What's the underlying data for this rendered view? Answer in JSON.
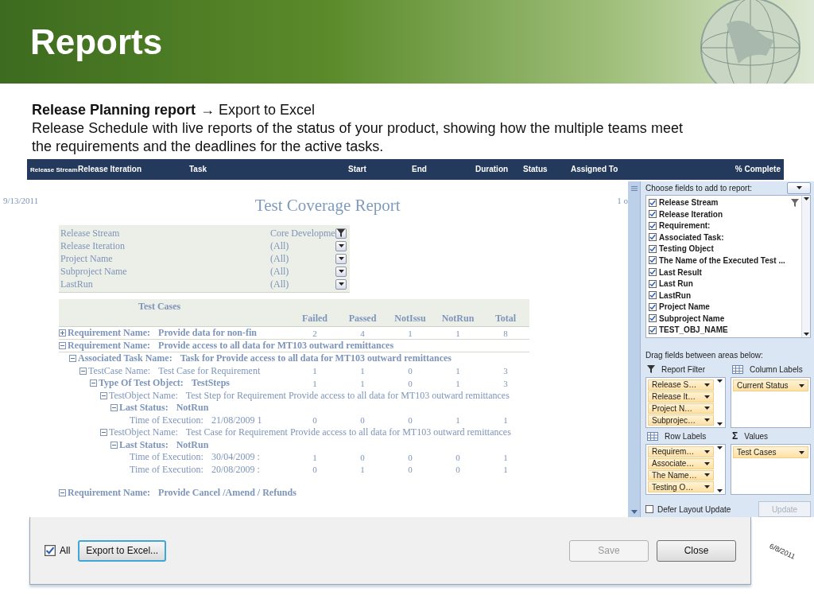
{
  "slide": {
    "title": "Reports"
  },
  "intro": {
    "heading": "Release Planning report",
    "link": "→ Export to Excel",
    "text": "Release Schedule with live reports of the status of your product, showing how the multiple teams meet the requirements and the deadlines for the active tasks."
  },
  "schedule_header": {
    "columns": [
      "Release Stream",
      "Release Iteration",
      "Task",
      "Start",
      "End",
      "Duration",
      "Status",
      "Assigned To",
      "% Complete"
    ]
  },
  "report": {
    "date": "9/13/2011",
    "title": "Test Coverage Report",
    "page": "1 o",
    "filters": [
      {
        "label": "Release Stream",
        "value": "Core Developme",
        "filtered": true
      },
      {
        "label": "Release Iteration",
        "value": "(All)",
        "filtered": false
      },
      {
        "label": "Project Name",
        "value": "(All)",
        "filtered": false
      },
      {
        "label": "Subproject Name",
        "value": "(All)",
        "filtered": false
      },
      {
        "label": "LastRun",
        "value": "(All)",
        "filtered": false
      }
    ],
    "table": {
      "caption": "Test Cases",
      "columns": [
        "Failed",
        "Passed",
        "NotIssu",
        "NotRun",
        "Total"
      ],
      "rows": [
        {
          "label": "Requirement Name:",
          "value": "Provide data for non-fin",
          "bold": true,
          "expanded": false,
          "cells": [
            "2",
            "4",
            "1",
            "1",
            "8"
          ]
        },
        {
          "label": "Requirement Name:",
          "value": "Provide access to all data for MT103 outward remittances",
          "bold": true,
          "expanded": true,
          "children": [
            {
              "label": "Associated Task Name:",
              "value": "Task for Provide access to all data for MT103 outward remittances",
              "bold": true,
              "expanded": true,
              "children": [
                {
                  "label": "TestCase Name:",
                  "value": "Test Case for Requirement",
                  "bold": false,
                  "expanded": true,
                  "cells": [
                    "1",
                    "1",
                    "0",
                    "1",
                    "3"
                  ],
                  "children": [
                    {
                      "label": "Type Of Test Object:",
                      "value": "TestSteps",
                      "bold": true,
                      "expanded": true,
                      "cells": [
                        "1",
                        "1",
                        "0",
                        "1",
                        "3"
                      ],
                      "children": [
                        {
                          "label": "TestObject Name:",
                          "value": "Test Step for Requirement Provide access to all data for MT103 outward remittances",
                          "bold": false,
                          "expanded": true,
                          "children": [
                            {
                              "label": "Last Status:",
                              "value": "NotRun",
                              "bold": true,
                              "expanded": true,
                              "children": [
                                {
                                  "label": "Time of Execution:",
                                  "value": "21/08/2009 1",
                                  "bold": false,
                                  "cells": [
                                    "0",
                                    "0",
                                    "0",
                                    "1",
                                    "1"
                                  ]
                                }
                              ]
                            }
                          ]
                        },
                        {
                          "label": "TestObject Name:",
                          "value": "Test Case for Requirement Provide access to all data for MT103 outward remittances",
                          "bold": false,
                          "expanded": true,
                          "children": [
                            {
                              "label": "Last Status:",
                              "value": "NotRun",
                              "bold": true,
                              "expanded": true,
                              "children": [
                                {
                                  "label": "Time of Execution:",
                                  "value": "30/04/2009 :",
                                  "bold": false,
                                  "cells": [
                                    "1",
                                    "0",
                                    "0",
                                    "0",
                                    "1"
                                  ]
                                },
                                {
                                  "label": "Time of Execution:",
                                  "value": "20/08/2009 :",
                                  "bold": false,
                                  "cells": [
                                    "0",
                                    "1",
                                    "0",
                                    "0",
                                    "1"
                                  ]
                                }
                              ]
                            }
                          ]
                        }
                      ]
                    }
                  ]
                }
              ]
            }
          ]
        },
        {
          "label": "Requirement Name:",
          "value": "Provide Cancel /Amend / Refunds",
          "bold": true,
          "expanded": true
        }
      ]
    }
  },
  "field_list": {
    "heading": "Choose fields to add to report:",
    "fields": [
      {
        "label": "Release Stream",
        "checked": true,
        "filtered": true
      },
      {
        "label": "Release Iteration",
        "checked": true,
        "filtered": false
      },
      {
        "label": "Requirement:",
        "checked": true,
        "filtered": false
      },
      {
        "label": "Associated Task:",
        "checked": true,
        "filtered": false
      },
      {
        "label": "Testing Object",
        "checked": true,
        "filtered": false
      },
      {
        "label": "The Name of the Executed Test ...",
        "checked": true,
        "filtered": false
      },
      {
        "label": "Last Result",
        "checked": true,
        "filtered": false
      },
      {
        "label": "Last Run",
        "checked": true,
        "filtered": false
      },
      {
        "label": "LastRun",
        "checked": true,
        "filtered": false
      },
      {
        "label": "Project Name",
        "checked": true,
        "filtered": false
      },
      {
        "label": "Subproject Name",
        "checked": true,
        "filtered": false
      },
      {
        "label": "TEST_OBJ_NAME",
        "checked": true,
        "filtered": false
      }
    ],
    "areas_heading": "Drag fields between areas below:",
    "areas": [
      {
        "kind": "filter",
        "title": "Report Filter",
        "items": [
          "Release S…",
          "Release It…",
          "Project N…",
          "Subprojec…"
        ]
      },
      {
        "kind": "columns",
        "title": "Column Labels",
        "items": [
          "Current Status"
        ]
      },
      {
        "kind": "rows",
        "title": "Row Labels",
        "items": [
          "Requirem…",
          "Associate…",
          "The Name…",
          "Testing O…"
        ]
      },
      {
        "kind": "values",
        "title": "Values",
        "symbol": "Σ",
        "items": [
          "Test Cases"
        ]
      }
    ],
    "defer": {
      "label": "Defer Layout Update",
      "checked": false
    },
    "update": {
      "label": "Update",
      "disabled": true
    }
  },
  "dialog": {
    "all": {
      "label": "All",
      "checked": true
    },
    "buttons": [
      {
        "label": "Export to Excel...",
        "focused": true,
        "disabled": false,
        "kind": "export"
      },
      {
        "label": "Save",
        "focused": false,
        "disabled": true,
        "kind": "action"
      },
      {
        "label": "Close",
        "focused": false,
        "disabled": false,
        "kind": "action"
      }
    ]
  },
  "side_date": "6/8/2011"
}
